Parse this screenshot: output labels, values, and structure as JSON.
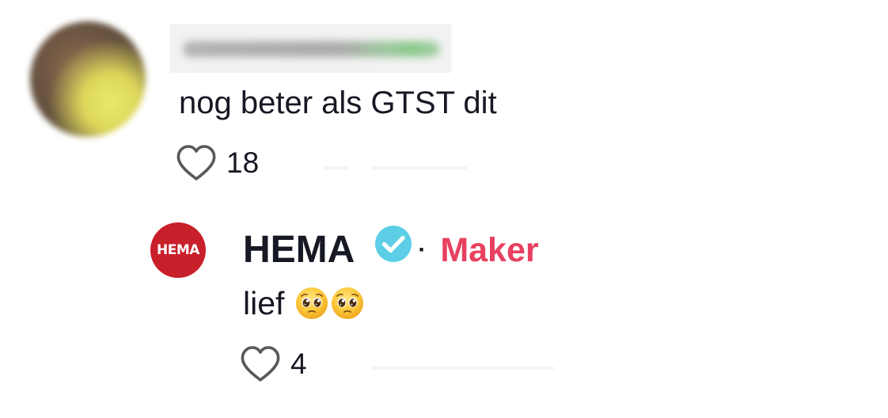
{
  "comment": {
    "text": "nog beter als GTST dit",
    "like_count": "18",
    "icons": {
      "avatar": "blurred-profile-photo",
      "username": "blurred-username",
      "like": "heart-outline-icon"
    }
  },
  "reply": {
    "avatar_label": "HEMA",
    "author": "HEMA",
    "separator": "·",
    "creator_label": "Maker",
    "text": "lief",
    "emojis": [
      "pleading-face-emoji",
      "pleading-face-emoji"
    ],
    "like_count": "4",
    "icons": {
      "verified": "verified-check-icon",
      "like": "heart-outline-icon"
    }
  },
  "colors": {
    "text": "#161823",
    "creator_label": "#e8405f",
    "verified_badge": "#5ccfe6",
    "hema_red": "#c8202a",
    "icon_outline": "#585858"
  }
}
